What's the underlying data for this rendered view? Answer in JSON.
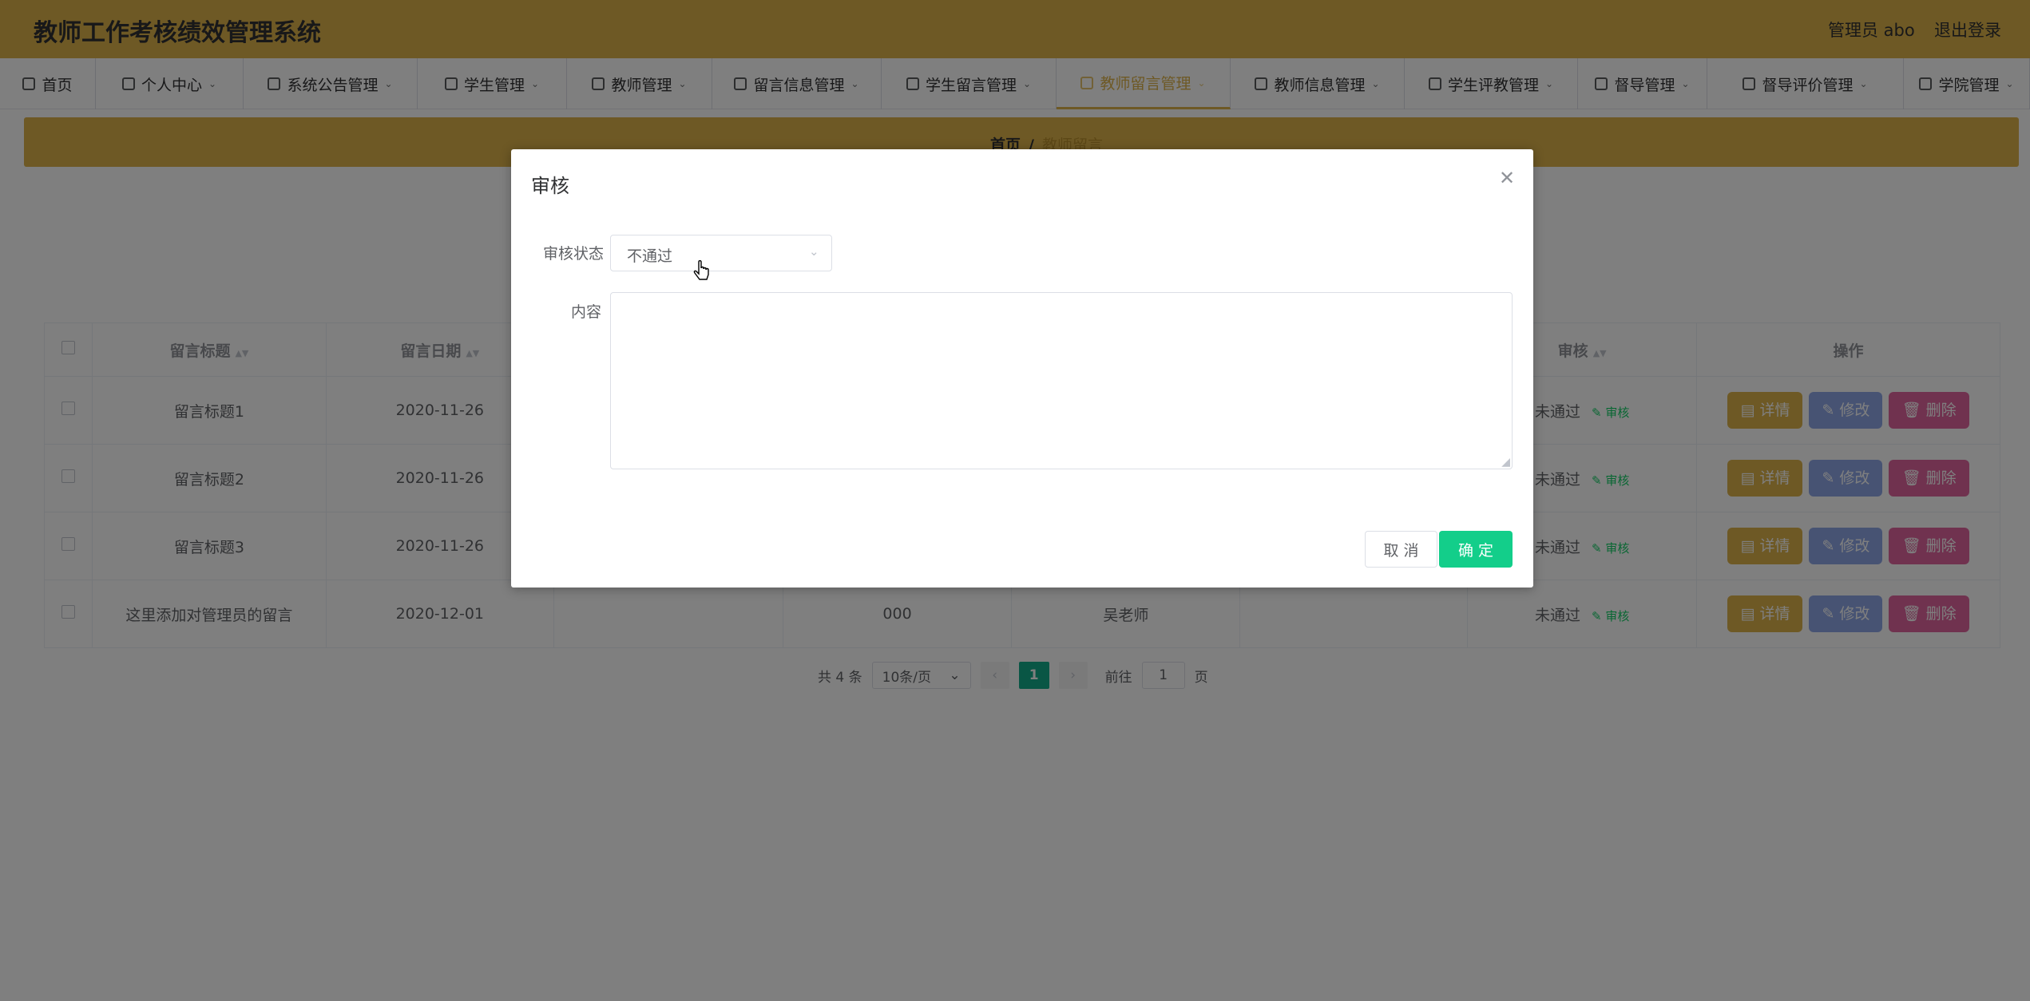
{
  "header": {
    "title": "教师工作考核绩效管理系统",
    "user": "管理员 abo",
    "logout": "退出登录"
  },
  "nav": [
    {
      "label": "首页",
      "icon": "home-icon",
      "chevron": false,
      "active": false
    },
    {
      "label": "个人中心",
      "icon": "user-icon",
      "chevron": true,
      "active": false
    },
    {
      "label": "系统公告管理",
      "icon": "sliders-icon",
      "chevron": true,
      "active": false
    },
    {
      "label": "学生管理",
      "icon": "chat-icon",
      "chevron": true,
      "active": false
    },
    {
      "label": "教师管理",
      "icon": "location-icon",
      "chevron": true,
      "active": false
    },
    {
      "label": "留言信息管理",
      "icon": "chart-icon",
      "chevron": true,
      "active": false
    },
    {
      "label": "学生留言管理",
      "icon": "clipboard-icon",
      "chevron": true,
      "active": false
    },
    {
      "label": "教师留言管理",
      "icon": "list-icon",
      "chevron": true,
      "active": true
    },
    {
      "label": "教师信息管理",
      "icon": "refresh-icon",
      "chevron": true,
      "active": false
    },
    {
      "label": "学生评教管理",
      "icon": "chat-icon",
      "chevron": true,
      "active": false
    },
    {
      "label": "督导管理",
      "icon": "globe-icon",
      "chevron": true,
      "active": false
    },
    {
      "label": "督导评价管理",
      "icon": "briefcase-icon",
      "chevron": true,
      "active": false
    },
    {
      "label": "学院管理",
      "icon": "user-icon",
      "chevron": true,
      "active": false
    }
  ],
  "breadcrumb": {
    "home": "首页",
    "separator": "/",
    "current": "教师留言"
  },
  "table": {
    "headers": {
      "title": "留言标题",
      "date": "留言日期",
      "audit": "审核",
      "ops": "操作"
    },
    "rows": [
      {
        "title": "留言标题1",
        "date": "2020-11-26",
        "content": "",
        "teacher": "",
        "status": "未通过"
      },
      {
        "title": "留言标题2",
        "date": "2020-11-26",
        "content": "",
        "teacher": "",
        "status": "未通过"
      },
      {
        "title": "留言标题3",
        "date": "2020-11-26",
        "content": "",
        "teacher": "",
        "status": "未通过"
      },
      {
        "title": "这里添加对管理员的留言",
        "date": "2020-12-01",
        "content": "000",
        "teacher": "吴老师",
        "status": "未通过"
      }
    ],
    "audit_link": "审核",
    "btn_detail": "详情",
    "btn_edit": "修改",
    "btn_delete": "删除"
  },
  "pagination": {
    "total": "共 4 条",
    "page_size": "10条/页",
    "current_page": "1",
    "goto_label": "前往",
    "goto_value": "1",
    "page_unit": "页"
  },
  "dialog": {
    "title": "审核",
    "status_label": "审核状态",
    "status_value": "不通过",
    "content_label": "内容",
    "content_value": "",
    "cancel": "取 消",
    "confirm": "确 定"
  },
  "colors": {
    "brand": "#ddb34a",
    "confirm": "#13ce8a",
    "edit": "#8ea6e6",
    "delete": "#e0649e"
  }
}
